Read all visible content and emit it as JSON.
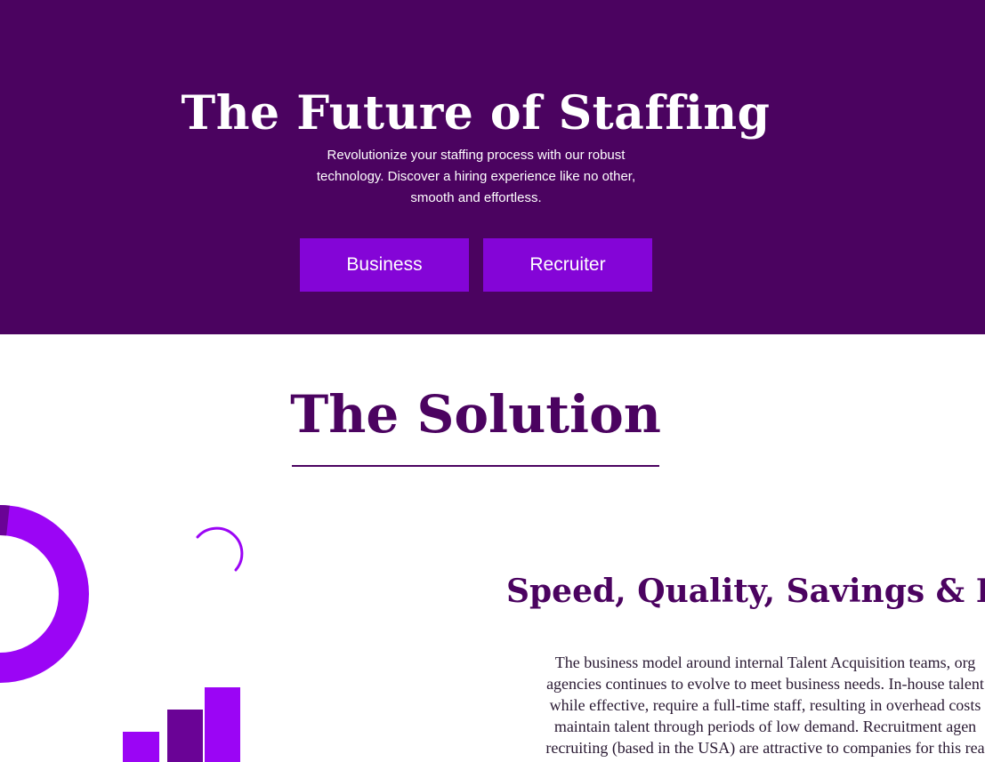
{
  "hero": {
    "title": "The Future of Staffing",
    "subtitle": "Revolutionize your staffing process with our robust technology. Discover a hiring experience like no other, smooth and effortless.",
    "buttons": {
      "business_label": "Business",
      "recruiter_label": "Recruiter"
    }
  },
  "solution": {
    "title": "The Solution",
    "feature_title": "Speed, Quality, Savings & In",
    "body_lines": [
      "The business model around internal Talent Acquisition teams, org",
      "agencies continues to evolve to meet business needs. In-house talent",
      "while effective, require a full-time staff, resulting in overhead costs",
      "maintain talent through periods of low demand. Recruitment agen",
      "recruiting (based in the USA) are attractive to companies for this rea"
    ]
  },
  "colors": {
    "hero_bg": "#4b0360",
    "button_bg": "#8405d7",
    "heading": "#4b0360",
    "accent_bright": "#9b05f5",
    "accent_dark": "#6a0396"
  },
  "icons": [
    "donut-chart-icon",
    "loading-arc-icon",
    "bar-chart-icon"
  ]
}
